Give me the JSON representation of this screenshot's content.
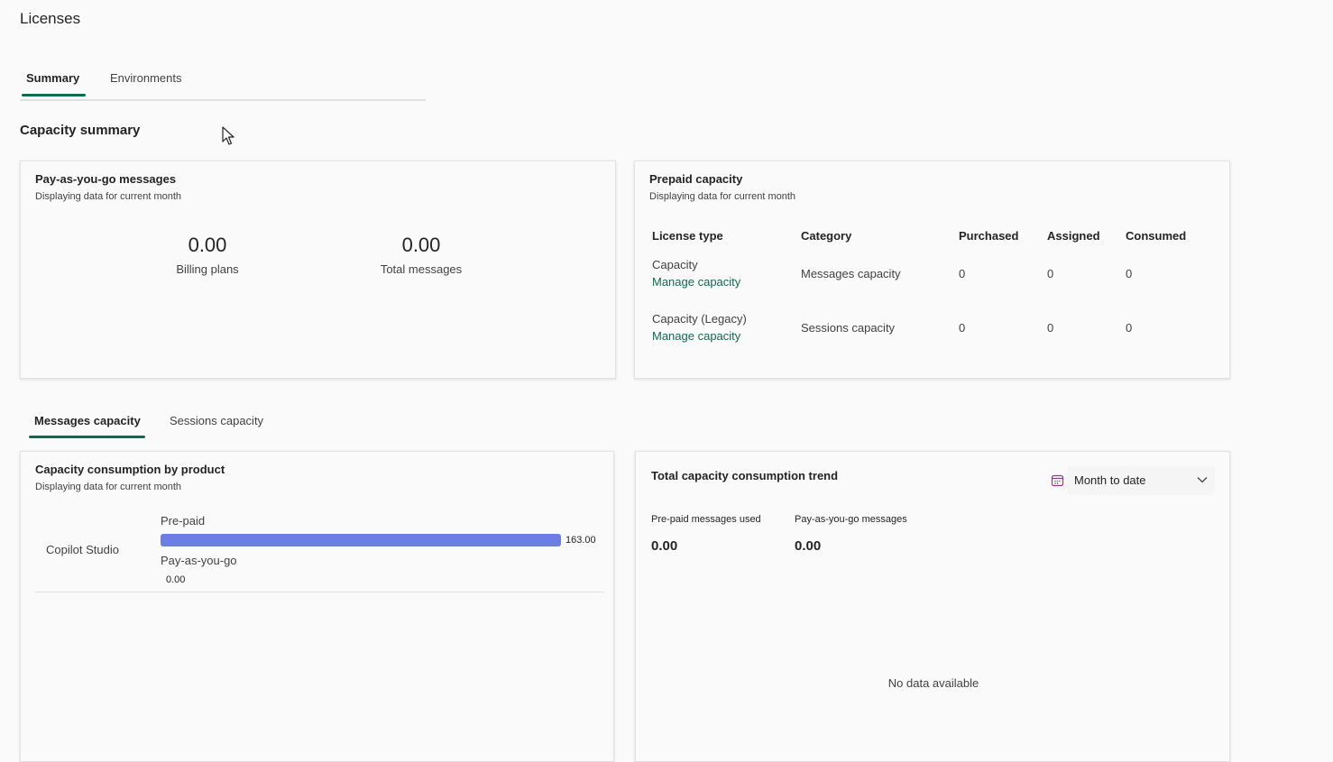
{
  "page": {
    "title": "Licenses"
  },
  "top_tabs": [
    {
      "label": "Summary",
      "active": true
    },
    {
      "label": "Environments",
      "active": false
    }
  ],
  "capacity_summary": {
    "title": "Capacity summary",
    "payg_card": {
      "title": "Pay-as-you-go messages",
      "subtitle": "Displaying data for current month",
      "metrics": [
        {
          "value": "0.00",
          "label": "Billing plans"
        },
        {
          "value": "0.00",
          "label": "Total messages"
        }
      ]
    },
    "prepaid_card": {
      "title": "Prepaid capacity",
      "subtitle": "Displaying data for current month",
      "columns": [
        "License type",
        "Category",
        "Purchased",
        "Assigned",
        "Consumed"
      ],
      "rows": [
        {
          "license_type": "Capacity",
          "link": "Manage capacity",
          "category": "Messages capacity",
          "purchased": "0",
          "assigned": "0",
          "consumed": "0"
        },
        {
          "license_type": "Capacity (Legacy)",
          "link": "Manage capacity",
          "category": "Sessions capacity",
          "purchased": "0",
          "assigned": "0",
          "consumed": "0"
        }
      ]
    }
  },
  "sub_tabs": [
    {
      "label": "Messages capacity",
      "active": true
    },
    {
      "label": "Sessions capacity",
      "active": false
    }
  ],
  "consumption_card": {
    "title": "Capacity consumption by product",
    "subtitle": "Displaying data for current month",
    "product": "Copilot Studio",
    "prepaid_label": "Pre-paid",
    "prepaid_value": "163.00",
    "payg_label": "Pay-as-you-go",
    "payg_value": "0.00"
  },
  "trend_card": {
    "title": "Total capacity consumption trend",
    "dropdown_value": "Month to date",
    "metrics": [
      {
        "label": "Pre-paid messages used",
        "value": "0.00"
      },
      {
        "label": "Pay-as-you-go messages",
        "value": "0.00"
      }
    ],
    "empty_text": "No data available"
  },
  "colors": {
    "accent": "#0f6b4f",
    "bar": "#6c7ee6",
    "calendar_icon": "#8a3d80"
  }
}
